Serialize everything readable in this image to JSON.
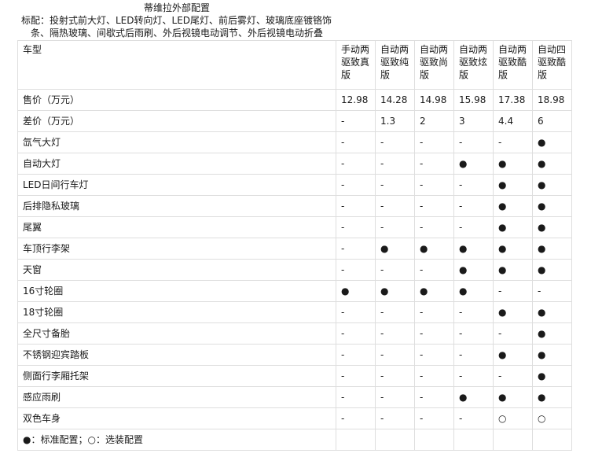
{
  "title": "蒂维拉外部配置",
  "standard_line1": "标配：投射式前大灯、LED转向灯、LED尾灯、前后雾灯、玻璃底座镀铬饰",
  "standard_line2": "条、隔热玻璃、间歇式后雨刷、外后视镜电动调节、外后视镜电动折叠",
  "header_label": "车型",
  "trims": [
    [
      "手动两",
      "驱致真",
      "版"
    ],
    [
      "自动两",
      "驱致纯",
      "版"
    ],
    [
      "自动两",
      "驱致尚",
      "版"
    ],
    [
      "自动两",
      "驱致炫",
      "版"
    ],
    [
      "自动两",
      "驱致酷",
      "版"
    ],
    [
      "自动四",
      "驱致酷",
      "版"
    ]
  ],
  "rows": [
    {
      "label": "售价（万元）",
      "values": [
        "12.98",
        "14.28",
        "14.98",
        "15.98",
        "17.38",
        "18.98"
      ]
    },
    {
      "label": "差价（万元）",
      "values": [
        "-",
        "1.3",
        "2",
        "3",
        "4.4",
        "6"
      ]
    },
    {
      "label": "氙气大灯",
      "values": [
        "-",
        "-",
        "-",
        "-",
        "-",
        "●"
      ]
    },
    {
      "label": "自动大灯",
      "values": [
        "-",
        "-",
        "-",
        "●",
        "●",
        "●"
      ]
    },
    {
      "label": "LED日间行车灯",
      "values": [
        "-",
        "-",
        "-",
        "-",
        "●",
        "●"
      ]
    },
    {
      "label": "后排隐私玻璃",
      "values": [
        "-",
        "-",
        "-",
        "-",
        "●",
        "●"
      ]
    },
    {
      "label": "尾翼",
      "values": [
        "-",
        "-",
        "-",
        "-",
        "●",
        "●"
      ]
    },
    {
      "label": "车顶行李架",
      "values": [
        "-",
        "●",
        "●",
        "●",
        "●",
        "●"
      ]
    },
    {
      "label": "天窗",
      "values": [
        "-",
        "-",
        "-",
        "●",
        "●",
        "●"
      ]
    },
    {
      "label": "16寸轮圈",
      "values": [
        "●",
        "●",
        "●",
        "●",
        "-",
        "-"
      ]
    },
    {
      "label": "18寸轮圈",
      "values": [
        "-",
        "-",
        "-",
        "-",
        "●",
        "●"
      ]
    },
    {
      "label": "全尺寸备胎",
      "values": [
        "-",
        "-",
        "-",
        "-",
        "-",
        "●"
      ]
    },
    {
      "label": "不锈钢迎宾踏板",
      "values": [
        "-",
        "-",
        "-",
        "-",
        "●",
        "●"
      ]
    },
    {
      "label": "侧面行李厢托架",
      "values": [
        "-",
        "-",
        "-",
        "-",
        "-",
        "●"
      ]
    },
    {
      "label": "感应雨刷",
      "values": [
        "-",
        "-",
        "-",
        "●",
        "●",
        "●"
      ]
    },
    {
      "label": "双色车身",
      "values": [
        "-",
        "-",
        "-",
        "-",
        "○",
        "○"
      ]
    }
  ],
  "legend": "●：标准配置；○：选装配置"
}
